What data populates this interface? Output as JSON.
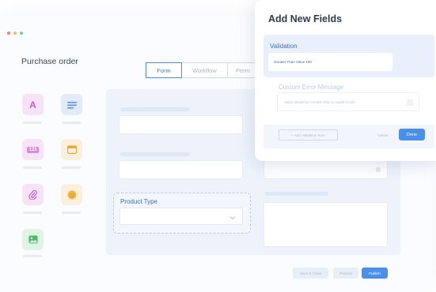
{
  "app": {
    "title": "Purchase order",
    "window_dots": [
      "#f87b8e",
      "#f5b95a",
      "#6fd39a"
    ]
  },
  "palette": {
    "items": [
      {
        "name": "text-field",
        "icon": "letter-a-icon",
        "glyph": "A",
        "bg": "#f6e3f5",
        "fg": "#c95fd0"
      },
      {
        "name": "paragraph-field",
        "icon": "paragraph-lines-icon",
        "bg": "#e3ebfb",
        "fg": "#5b8fe6"
      },
      {
        "name": "number-field",
        "icon": "number-icon",
        "glyph": "123",
        "bg": "#f6e3f5",
        "fg": "#c95fd0"
      },
      {
        "name": "date-field",
        "icon": "calendar-icon",
        "bg": "#fbf0dc",
        "fg": "#e3a93c"
      },
      {
        "name": "attachment-field",
        "icon": "paperclip-icon",
        "bg": "#f6e3f5",
        "fg": "#c95fd0"
      },
      {
        "name": "emoji-field",
        "icon": "emoji-icon",
        "bg": "#fbf0dc",
        "fg": "#e3a93c"
      },
      {
        "name": "image-field",
        "icon": "image-icon",
        "bg": "#e1f3e4",
        "fg": "#4cb86a"
      }
    ]
  },
  "tabs": [
    {
      "label": "Form",
      "active": true
    },
    {
      "label": "Workflow",
      "active": false
    },
    {
      "label": "Perm",
      "active": false
    }
  ],
  "form": {
    "product_type_label": "Product Type"
  },
  "footer": {
    "save_close": "Save & Close",
    "preview": "Preview",
    "publish": "Publish"
  },
  "panel": {
    "title": "Add New Fields",
    "validation_label": "Validation",
    "validation_value": "Greater Than Value 100",
    "error_label": "Custom Error Message",
    "error_value": "Value should be Greater than or equal to 100",
    "add_rule": "+ Add Validation Rule",
    "delete": "Delete",
    "done": "Done"
  },
  "colors": {
    "accent": "#4a8fe8",
    "canvas": "#eef3fb",
    "title": "#2f3a4b"
  }
}
